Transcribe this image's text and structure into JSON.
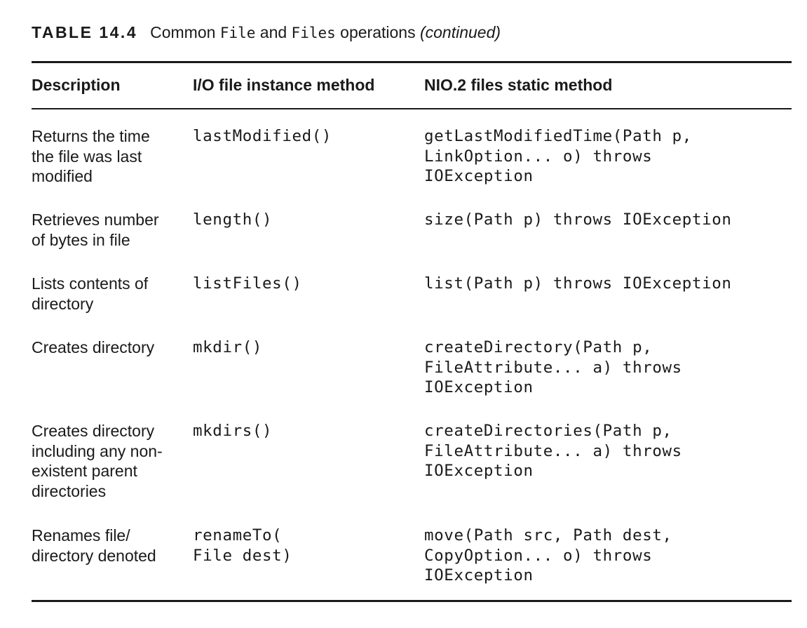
{
  "caption": {
    "label": "TABLE 14.4",
    "text_part1": "Common ",
    "mono1": "File",
    "text_part2": " and ",
    "mono2": "Files",
    "text_part3": " operations ",
    "continued": "(continued)"
  },
  "table": {
    "headers": {
      "description": "Description",
      "io": "I/O file instance method",
      "nio": "NIO.2 files static method"
    },
    "rows": [
      {
        "description": [
          "Returns the time",
          "the file was last",
          "modified"
        ],
        "io": [
          "lastModified()"
        ],
        "nio": [
          "getLastModifiedTime(Path p,",
          "LinkOption... o) throws",
          "IOException"
        ]
      },
      {
        "description": [
          "Retrieves number",
          "of bytes in file"
        ],
        "io": [
          "length()"
        ],
        "nio": [
          "size(Path p) throws IOException"
        ]
      },
      {
        "description": [
          "Lists contents of",
          "directory"
        ],
        "io": [
          "listFiles()"
        ],
        "nio": [
          "list(Path p) throws IOException"
        ]
      },
      {
        "description": [
          "Creates directory"
        ],
        "io": [
          "mkdir()"
        ],
        "nio": [
          "createDirectory(Path p,",
          "FileAttribute... a) throws",
          "IOException"
        ]
      },
      {
        "description": [
          "Creates directory",
          "including any non-",
          "existent parent",
          "directories"
        ],
        "io": [
          "mkdirs()"
        ],
        "nio": [
          "createDirectories(Path p,",
          "FileAttribute... a) throws",
          "IOException"
        ]
      },
      {
        "description": [
          "Renames file/",
          "directory denoted"
        ],
        "io": [
          "renameTo(",
          "File dest)"
        ],
        "nio": [
          "move(Path src, Path dest,",
          "CopyOption... o) throws",
          "IOException"
        ]
      }
    ]
  }
}
